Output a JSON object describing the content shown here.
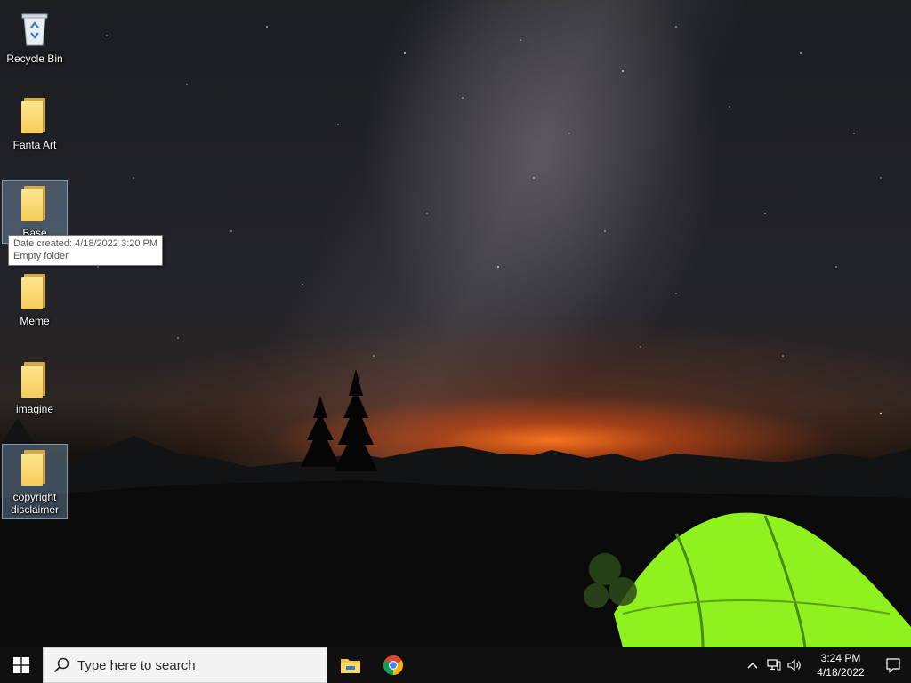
{
  "desktop": {
    "icons": [
      {
        "label": "Recycle Bin",
        "icon": "recycle-bin-icon"
      },
      {
        "label": "Fanta Art",
        "icon": "folder-icon"
      },
      {
        "label": "Base",
        "icon": "folder-icon"
      },
      {
        "label": "Meme",
        "icon": "folder-icon"
      },
      {
        "label": "imagine",
        "icon": "folder-icon"
      },
      {
        "label": "copyright disclaimer",
        "icon": "folder-icon"
      }
    ],
    "tooltip": {
      "line1": "Date created: 4/18/2022 3:20 PM",
      "line2": "Empty folder"
    }
  },
  "taskbar": {
    "start_icon": "windows-logo-icon",
    "search_placeholder": "Type here to search",
    "pinned": [
      {
        "name": "File Explorer",
        "icon": "file-explorer-icon"
      },
      {
        "name": "Google Chrome",
        "icon": "chrome-icon"
      }
    ],
    "tray": {
      "icons": [
        "chevron-up-icon",
        "network-icon",
        "volume-icon"
      ],
      "time": "3:24 PM",
      "date": "4/18/2022",
      "notification_icon": "notification-icon"
    }
  },
  "colors": {
    "taskbar_bg": "#101010",
    "search_bg": "#f3f3f3",
    "tent_green": "#8ff21f",
    "horizon_glow": "#ff7a1e"
  }
}
